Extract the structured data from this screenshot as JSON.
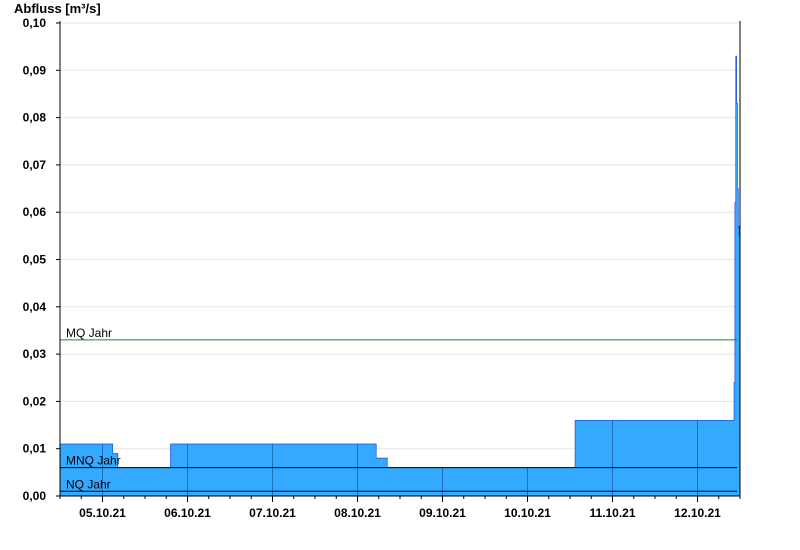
{
  "chart_data": {
    "type": "area",
    "title": "",
    "ylabel": "Abfluss [m³/s]",
    "xlabel": "",
    "ylim": [
      0,
      0.1
    ],
    "yticks": [
      0.0,
      0.01,
      0.02,
      0.03,
      0.04,
      0.05,
      0.06,
      0.07,
      0.08,
      0.09,
      0.1
    ],
    "ytick_labels": [
      "0,00",
      "0,01",
      "0,02",
      "0,03",
      "0,04",
      "0,05",
      "0,06",
      "0,07",
      "0,08",
      "0,09",
      "0,10"
    ],
    "xlim_days": [
      4.5,
      12.5
    ],
    "xtick_labels": [
      "05.10.21",
      "06.10.21",
      "07.10.21",
      "08.10.21",
      "09.10.21",
      "10.10.21",
      "11.10.21",
      "12.10.21"
    ],
    "grid": true,
    "area_color": "#33aaff",
    "series": [
      {
        "x": [
          4.5,
          5.0,
          5.12,
          5.18,
          5.8,
          5.85,
          5.99,
          8.18,
          8.22,
          8.3,
          8.35,
          10.55,
          10.56,
          11.47,
          11.8,
          12.42,
          12.43,
          12.44,
          12.45,
          12.46,
          12.47,
          12.48,
          12.49,
          12.5
        ],
        "values": [
          0.011,
          0.011,
          0.009,
          0.006,
          0.011,
          0.011,
          0.011,
          0.011,
          0.008,
          0.008,
          0.006,
          0.006,
          0.016,
          0.016,
          0.016,
          0.016,
          0.024,
          0.062,
          0.093,
          0.083,
          0.065,
          0.057,
          0.055,
          0.055
        ]
      }
    ],
    "reference_lines": [
      {
        "name": "MQ Jahr",
        "value": 0.033,
        "color": "#2e7d2e"
      },
      {
        "name": "MNQ Jahr",
        "value": 0.006,
        "color": "#000000"
      },
      {
        "name": "NQ Jahr",
        "value": 0.001,
        "color": "#000000"
      }
    ]
  }
}
